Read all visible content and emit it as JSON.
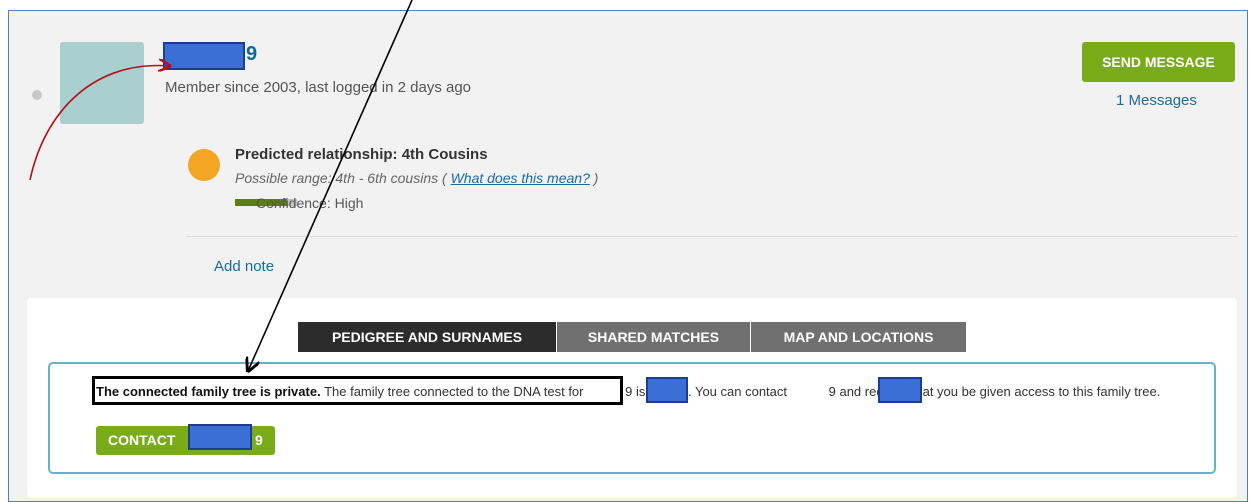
{
  "profile": {
    "username_suffix": "9",
    "member_since": "Member since 2003, last logged in 2 days ago",
    "send_message": "SEND MESSAGE",
    "messages": "1 Messages"
  },
  "relationship": {
    "title": "Predicted relationship: 4th Cousins",
    "range_prefix": "Possible range: 4th - 6th cousins ( ",
    "range_link": "What does this mean?",
    "range_suffix": " )",
    "confidence": "Confidence: High",
    "confidence_level": 0.84
  },
  "add_note": "Add note",
  "tabs": [
    "PEDIGREE AND SURNAMES",
    "SHARED MATCHES",
    "MAP AND LOCATIONS"
  ],
  "notice": {
    "bold": "The connected family tree is private.",
    "part1": " The family tree connected to the DNA test for ",
    "suffix1": "9",
    "part2": " is private. You can contact ",
    "suffix2": "9",
    "part3": " and request that you be given access to this family tree."
  },
  "contact": {
    "label": "CONTACT",
    "suffix": "9"
  },
  "colors": {
    "accent_green": "#7aac1a",
    "link_blue": "#1b6b9c",
    "redaction": "#3b6fd6",
    "annotation_red": "#b0121b"
  }
}
